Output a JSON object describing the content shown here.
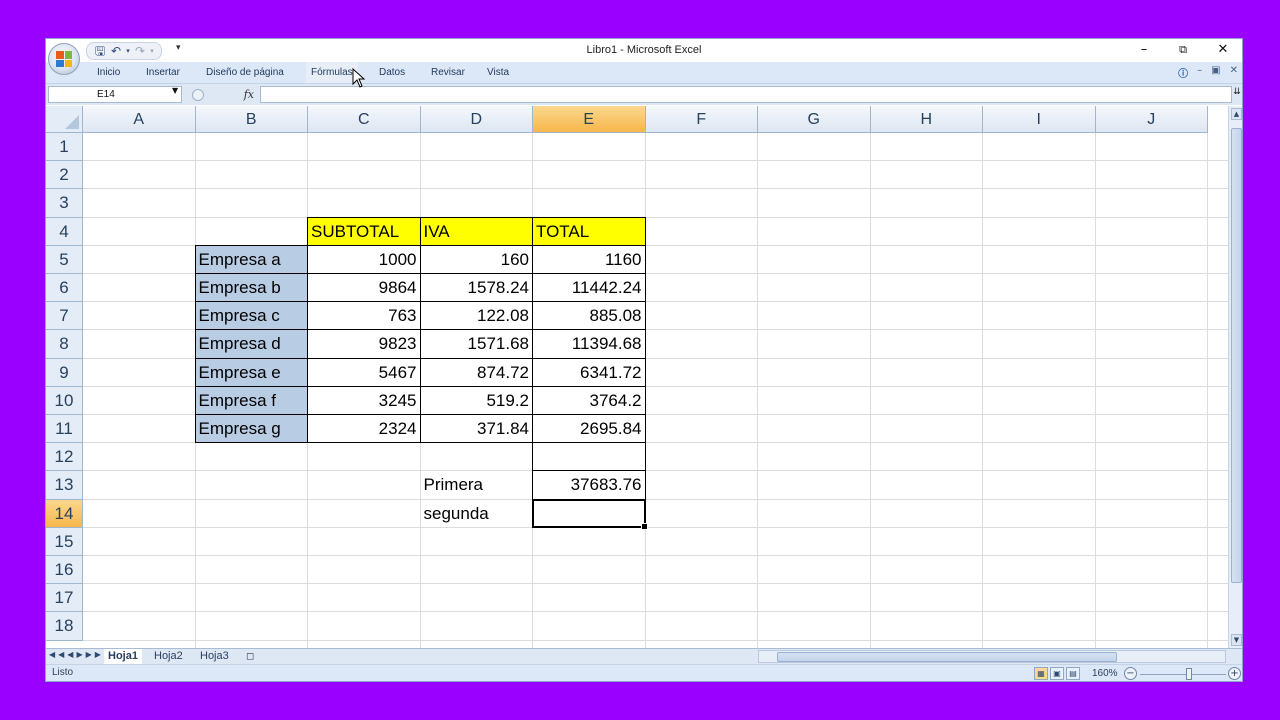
{
  "window": {
    "title": "Libro1 - Microsoft Excel"
  },
  "qat": {
    "icons": [
      "save-icon",
      "undo-icon",
      "redo-icon"
    ]
  },
  "menu": {
    "tabs": [
      "Inicio",
      "Insertar",
      "Diseño de página",
      "Fórmulas",
      "Datos",
      "Revisar",
      "Vista"
    ],
    "hovered": "Fórmulas"
  },
  "formula_bar": {
    "name_box": "E14",
    "fx_label": "fx",
    "content": ""
  },
  "columns": [
    "A",
    "B",
    "C",
    "D",
    "E",
    "F",
    "G",
    "H",
    "I",
    "J"
  ],
  "selected_column": "E",
  "rows": [
    "1",
    "2",
    "3",
    "4",
    "5",
    "6",
    "7",
    "8",
    "9",
    "10",
    "11",
    "12",
    "13",
    "14",
    "15",
    "16",
    "17",
    "18"
  ],
  "selected_row": "14",
  "table": {
    "headers": [
      "SUBTOTAL",
      "IVA",
      "TOTAL"
    ],
    "rows": [
      {
        "label": "Empresa a",
        "subtotal": "1000",
        "iva": "160",
        "total": "1160"
      },
      {
        "label": "Empresa b",
        "subtotal": "9864",
        "iva": "1578.24",
        "total": "11442.24"
      },
      {
        "label": "Empresa c",
        "subtotal": "763",
        "iva": "122.08",
        "total": "885.08"
      },
      {
        "label": "Empresa d",
        "subtotal": "9823",
        "iva": "1571.68",
        "total": "11394.68"
      },
      {
        "label": "Empresa e",
        "subtotal": "5467",
        "iva": "874.72",
        "total": "6341.72"
      },
      {
        "label": "Empresa f",
        "subtotal": "3245",
        "iva": "519.2",
        "total": "3764.2"
      },
      {
        "label": "Empresa g",
        "subtotal": "2324",
        "iva": "371.84",
        "total": "2695.84"
      }
    ]
  },
  "summary": {
    "primera_label": "Primera",
    "primera_value": "37683.76",
    "segunda_label": "segunda",
    "segunda_value": ""
  },
  "sheets": {
    "tabs": [
      "Hoja1",
      "Hoja2",
      "Hoja3"
    ],
    "active": "Hoja1"
  },
  "status": {
    "text": "Listo",
    "zoom": "160%"
  },
  "colors": {
    "header_yellow": "#ffff00",
    "label_blue": "#b8cce4",
    "selected_header": "#f7b64b",
    "background": "#9a00ff"
  }
}
